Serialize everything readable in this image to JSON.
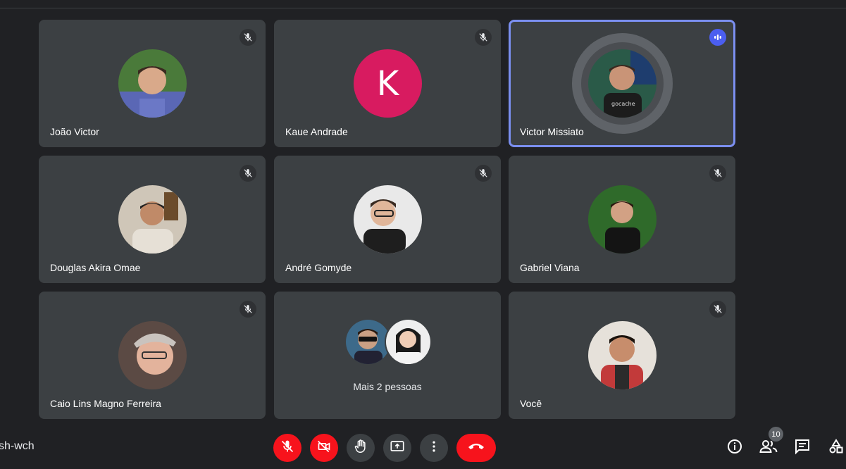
{
  "participants": [
    {
      "name": "João Victor",
      "muted": true,
      "avatar": "photo-joao"
    },
    {
      "name": "Kaue Andrade",
      "muted": true,
      "avatar_letter": "K",
      "avatar_color": "#d81b60"
    },
    {
      "name": "Victor Missiato",
      "speaking": true,
      "avatar": "photo-victor"
    },
    {
      "name": "Douglas Akira Omae",
      "muted": true,
      "avatar": "photo-douglas"
    },
    {
      "name": "André Gomyde",
      "muted": true,
      "avatar": "photo-andre"
    },
    {
      "name": "Gabriel Viana",
      "muted": true,
      "avatar": "photo-gabriel"
    },
    {
      "name": "Caio Lins Magno Ferreira",
      "muted": true,
      "avatar": "photo-caio"
    },
    {
      "name": "Mais 2 pessoas",
      "group": true
    },
    {
      "name": "Você",
      "muted": true,
      "avatar": "photo-voce"
    }
  ],
  "meeting": {
    "code": "sh-wch"
  },
  "people_count": "10",
  "colors": {
    "background": "#202124",
    "tile": "#3c4043",
    "speaking_border": "#7b8ff0",
    "danger": "#f7131c"
  },
  "controls": [
    "mic-off-icon",
    "camera-off-icon",
    "raise-hand-icon",
    "present-screen-icon",
    "more-options-icon",
    "end-call-icon"
  ],
  "right_controls": [
    "info-icon",
    "people-icon",
    "chat-icon",
    "activities-icon"
  ]
}
